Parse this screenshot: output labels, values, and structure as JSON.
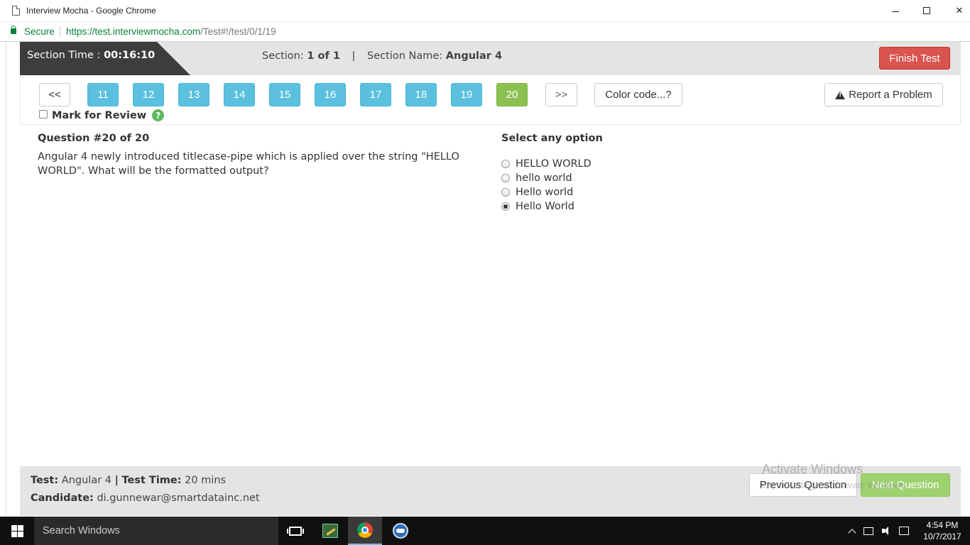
{
  "browser": {
    "window_title": "Interview Mocha - Google Chrome",
    "secure_label": "Secure",
    "url_host": "https://test.interviewmocha.com",
    "url_path": "/Test#!/test/0/1/19"
  },
  "section": {
    "time_label": "Section Time :",
    "time_value": "00:16:10",
    "section_label": "Section:",
    "section_value": "1 of 1",
    "divider": "|",
    "name_label": "Section Name:",
    "name_value": "Angular 4",
    "finish_label": "Finish Test"
  },
  "nav": {
    "prev_label": "<<",
    "next_label": ">>",
    "questions": [
      "11",
      "12",
      "13",
      "14",
      "15",
      "16",
      "17",
      "18",
      "19",
      "20"
    ],
    "current_question": "20",
    "color_code_label": "Color code...?",
    "report_label": "Report a Problem",
    "mark_review_label": "Mark for Review",
    "help_symbol": "?"
  },
  "question": {
    "title": "Question #20 of 20",
    "text": "Angular 4 newly introduced titlecase-pipe which is applied over the string \"HELLO WORLD\". What will be the formatted output?",
    "options_heading": "Select any option",
    "options": [
      "HELLO WORLD",
      "hello world",
      "Hello world",
      "Hello World"
    ],
    "selected_option": "Hello World"
  },
  "footer": {
    "test_label": "Test:",
    "test_value": "Angular 4",
    "divider": "|",
    "time_label": "Test Time:",
    "time_value": "20 mins",
    "candidate_label": "Candidate:",
    "candidate_value": "di.gunnewar@smartdatainc.net",
    "prev_button": "Previous Question",
    "next_button": "Next Question"
  },
  "watermark": {
    "line1": "Activate Windows",
    "line2": "Go to Settings to activate Windows."
  },
  "taskbar": {
    "search_placeholder": "Search Windows",
    "time": "4:54 PM",
    "date": "10/7/2017"
  },
  "colors": {
    "question_button": "#5bc0de",
    "current_question": "#8cc152",
    "finish_button": "#d9534f",
    "header_dark": "#3d3d3d"
  }
}
